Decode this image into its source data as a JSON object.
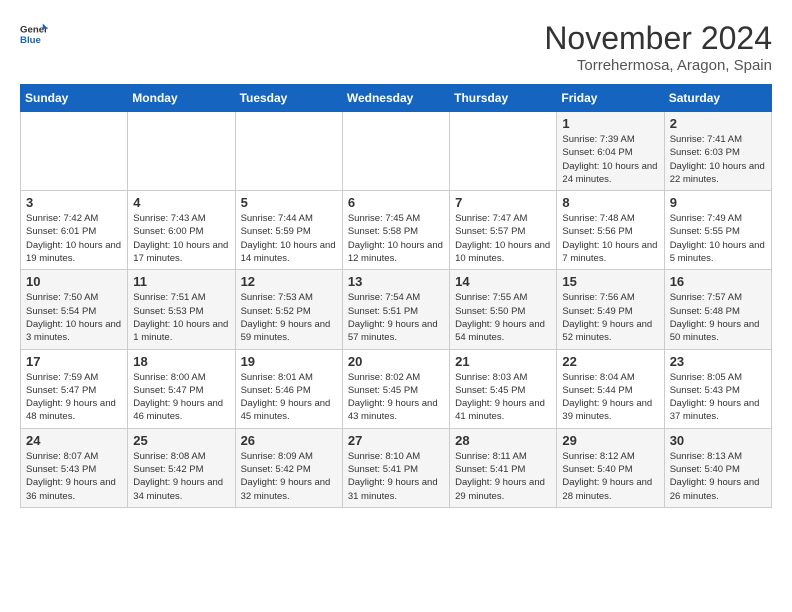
{
  "header": {
    "logo_general": "General",
    "logo_blue": "Blue",
    "month_title": "November 2024",
    "location": "Torrehermosa, Aragon, Spain"
  },
  "weekdays": [
    "Sunday",
    "Monday",
    "Tuesday",
    "Wednesday",
    "Thursday",
    "Friday",
    "Saturday"
  ],
  "weeks": [
    [
      {
        "day": "",
        "info": ""
      },
      {
        "day": "",
        "info": ""
      },
      {
        "day": "",
        "info": ""
      },
      {
        "day": "",
        "info": ""
      },
      {
        "day": "",
        "info": ""
      },
      {
        "day": "1",
        "info": "Sunrise: 7:39 AM\nSunset: 6:04 PM\nDaylight: 10 hours and 24 minutes."
      },
      {
        "day": "2",
        "info": "Sunrise: 7:41 AM\nSunset: 6:03 PM\nDaylight: 10 hours and 22 minutes."
      }
    ],
    [
      {
        "day": "3",
        "info": "Sunrise: 7:42 AM\nSunset: 6:01 PM\nDaylight: 10 hours and 19 minutes."
      },
      {
        "day": "4",
        "info": "Sunrise: 7:43 AM\nSunset: 6:00 PM\nDaylight: 10 hours and 17 minutes."
      },
      {
        "day": "5",
        "info": "Sunrise: 7:44 AM\nSunset: 5:59 PM\nDaylight: 10 hours and 14 minutes."
      },
      {
        "day": "6",
        "info": "Sunrise: 7:45 AM\nSunset: 5:58 PM\nDaylight: 10 hours and 12 minutes."
      },
      {
        "day": "7",
        "info": "Sunrise: 7:47 AM\nSunset: 5:57 PM\nDaylight: 10 hours and 10 minutes."
      },
      {
        "day": "8",
        "info": "Sunrise: 7:48 AM\nSunset: 5:56 PM\nDaylight: 10 hours and 7 minutes."
      },
      {
        "day": "9",
        "info": "Sunrise: 7:49 AM\nSunset: 5:55 PM\nDaylight: 10 hours and 5 minutes."
      }
    ],
    [
      {
        "day": "10",
        "info": "Sunrise: 7:50 AM\nSunset: 5:54 PM\nDaylight: 10 hours and 3 minutes."
      },
      {
        "day": "11",
        "info": "Sunrise: 7:51 AM\nSunset: 5:53 PM\nDaylight: 10 hours and 1 minute."
      },
      {
        "day": "12",
        "info": "Sunrise: 7:53 AM\nSunset: 5:52 PM\nDaylight: 9 hours and 59 minutes."
      },
      {
        "day": "13",
        "info": "Sunrise: 7:54 AM\nSunset: 5:51 PM\nDaylight: 9 hours and 57 minutes."
      },
      {
        "day": "14",
        "info": "Sunrise: 7:55 AM\nSunset: 5:50 PM\nDaylight: 9 hours and 54 minutes."
      },
      {
        "day": "15",
        "info": "Sunrise: 7:56 AM\nSunset: 5:49 PM\nDaylight: 9 hours and 52 minutes."
      },
      {
        "day": "16",
        "info": "Sunrise: 7:57 AM\nSunset: 5:48 PM\nDaylight: 9 hours and 50 minutes."
      }
    ],
    [
      {
        "day": "17",
        "info": "Sunrise: 7:59 AM\nSunset: 5:47 PM\nDaylight: 9 hours and 48 minutes."
      },
      {
        "day": "18",
        "info": "Sunrise: 8:00 AM\nSunset: 5:47 PM\nDaylight: 9 hours and 46 minutes."
      },
      {
        "day": "19",
        "info": "Sunrise: 8:01 AM\nSunset: 5:46 PM\nDaylight: 9 hours and 45 minutes."
      },
      {
        "day": "20",
        "info": "Sunrise: 8:02 AM\nSunset: 5:45 PM\nDaylight: 9 hours and 43 minutes."
      },
      {
        "day": "21",
        "info": "Sunrise: 8:03 AM\nSunset: 5:45 PM\nDaylight: 9 hours and 41 minutes."
      },
      {
        "day": "22",
        "info": "Sunrise: 8:04 AM\nSunset: 5:44 PM\nDaylight: 9 hours and 39 minutes."
      },
      {
        "day": "23",
        "info": "Sunrise: 8:05 AM\nSunset: 5:43 PM\nDaylight: 9 hours and 37 minutes."
      }
    ],
    [
      {
        "day": "24",
        "info": "Sunrise: 8:07 AM\nSunset: 5:43 PM\nDaylight: 9 hours and 36 minutes."
      },
      {
        "day": "25",
        "info": "Sunrise: 8:08 AM\nSunset: 5:42 PM\nDaylight: 9 hours and 34 minutes."
      },
      {
        "day": "26",
        "info": "Sunrise: 8:09 AM\nSunset: 5:42 PM\nDaylight: 9 hours and 32 minutes."
      },
      {
        "day": "27",
        "info": "Sunrise: 8:10 AM\nSunset: 5:41 PM\nDaylight: 9 hours and 31 minutes."
      },
      {
        "day": "28",
        "info": "Sunrise: 8:11 AM\nSunset: 5:41 PM\nDaylight: 9 hours and 29 minutes."
      },
      {
        "day": "29",
        "info": "Sunrise: 8:12 AM\nSunset: 5:40 PM\nDaylight: 9 hours and 28 minutes."
      },
      {
        "day": "30",
        "info": "Sunrise: 8:13 AM\nSunset: 5:40 PM\nDaylight: 9 hours and 26 minutes."
      }
    ]
  ]
}
